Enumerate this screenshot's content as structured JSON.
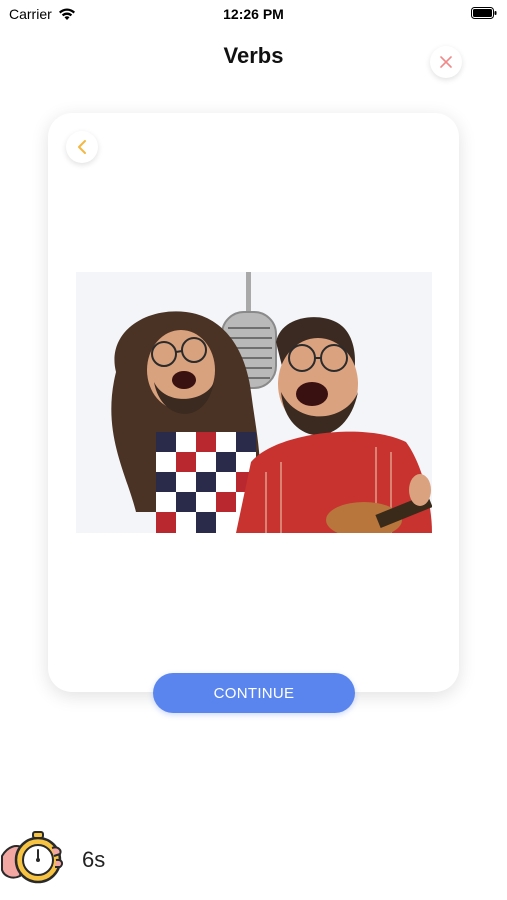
{
  "status_bar": {
    "carrier": "Carrier",
    "time": "12:26 PM",
    "icons": [
      "wifi-icon",
      "battery-icon"
    ]
  },
  "header": {
    "title": "Verbs",
    "close_icon": "close-icon"
  },
  "card": {
    "back_icon": "chevron-left-icon",
    "image_subject": "photo",
    "continue_label": "CONTINUE"
  },
  "timer": {
    "icon": "stopwatch-icon",
    "value": "6s"
  },
  "colors": {
    "accent_blue": "#5b85ee",
    "back_chevron": "#f4b740",
    "close_x": "#f08a8a"
  }
}
